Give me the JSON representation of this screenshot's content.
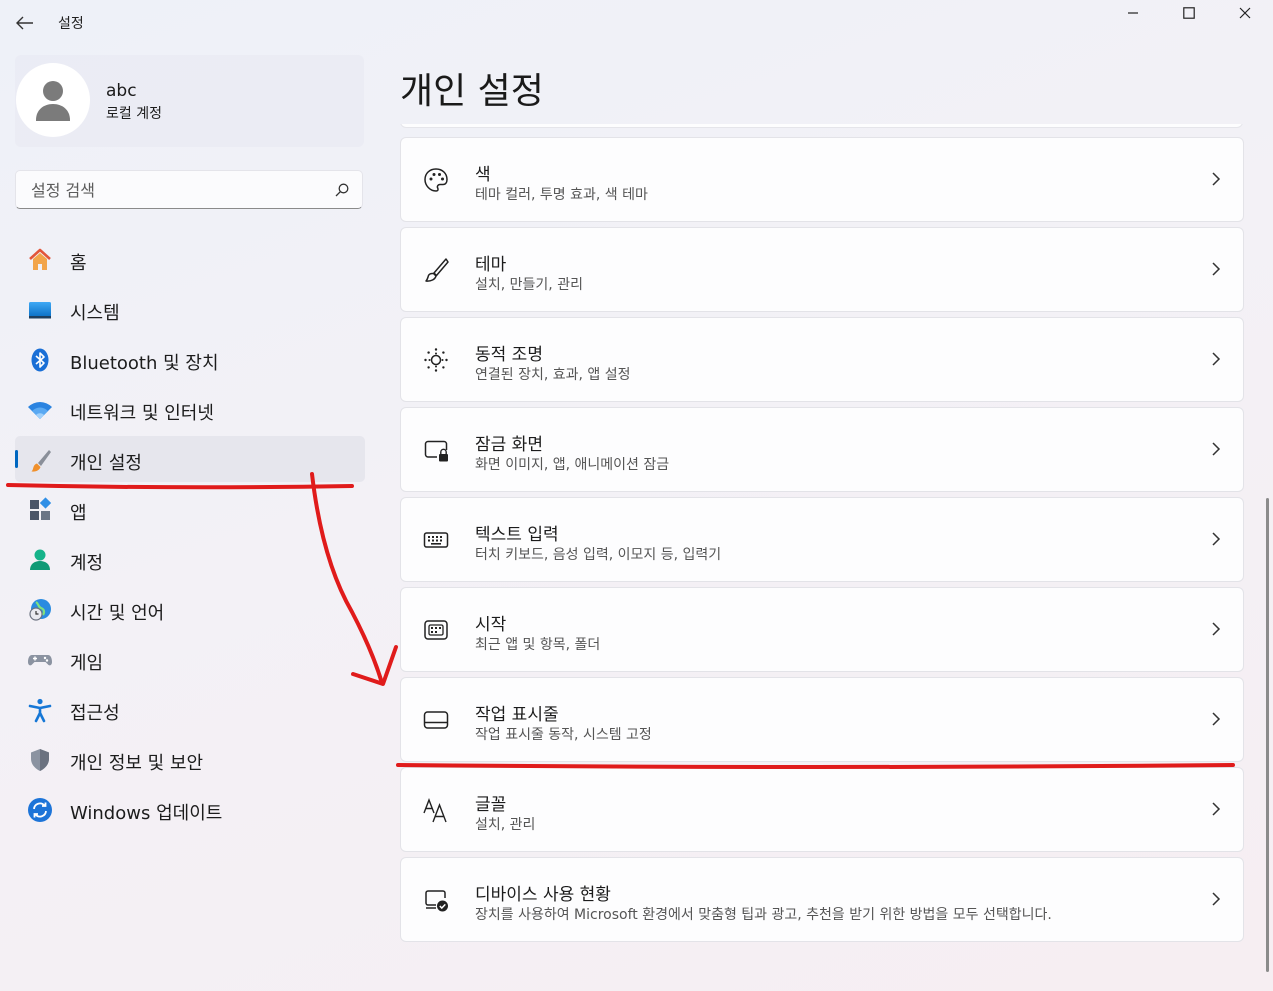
{
  "window": {
    "title": "설정"
  },
  "profile": {
    "name": "abc",
    "account_type": "로컬 계정"
  },
  "search": {
    "placeholder": "설정 검색"
  },
  "nav": {
    "items": [
      {
        "label": "홈",
        "icon": "home-icon"
      },
      {
        "label": "시스템",
        "icon": "system-icon"
      },
      {
        "label": "Bluetooth 및 장치",
        "icon": "bluetooth-icon"
      },
      {
        "label": "네트워크 및 인터넷",
        "icon": "wifi-icon"
      },
      {
        "label": "개인 설정",
        "icon": "paintbrush-icon",
        "active": true
      },
      {
        "label": "앱",
        "icon": "apps-icon"
      },
      {
        "label": "계정",
        "icon": "account-icon"
      },
      {
        "label": "시간 및 언어",
        "icon": "globe-clock-icon"
      },
      {
        "label": "게임",
        "icon": "gamepad-icon"
      },
      {
        "label": "접근성",
        "icon": "accessibility-icon"
      },
      {
        "label": "개인 정보 및 보안",
        "icon": "shield-icon"
      },
      {
        "label": "Windows 업데이트",
        "icon": "update-icon"
      }
    ]
  },
  "page": {
    "title": "개인 설정"
  },
  "cards": [
    {
      "title": "색",
      "subtitle": "테마 컬러, 투명 효과, 색 테마",
      "icon": "palette-icon"
    },
    {
      "title": "테마",
      "subtitle": "설치, 만들기, 관리",
      "icon": "brush-icon"
    },
    {
      "title": "동적 조명",
      "subtitle": "연결된 장치, 효과, 앱 설정",
      "icon": "dynamic-lighting-icon"
    },
    {
      "title": "잠금 화면",
      "subtitle": "화면 이미지, 앱, 애니메이션 잠금",
      "icon": "lock-screen-icon"
    },
    {
      "title": "텍스트 입력",
      "subtitle": "터치 키보드, 음성 입력, 이모지 등, 입력기",
      "icon": "keyboard-icon"
    },
    {
      "title": "시작",
      "subtitle": "최근 앱 및 항목, 폴더",
      "icon": "start-icon"
    },
    {
      "title": "작업 표시줄",
      "subtitle": "작업 표시줄 동작, 시스템 고정",
      "icon": "taskbar-icon"
    },
    {
      "title": "글꼴",
      "subtitle": "설치, 관리",
      "icon": "fonts-icon"
    },
    {
      "title": "디바이스 사용 현황",
      "subtitle": "장치를 사용하여 Microsoft 환경에서 맞춤형 팁과 광고, 추천을 받기 위한 방법을 모두 선택합니다.",
      "icon": "device-usage-icon"
    }
  ],
  "colors": {
    "accent": "#0067c0",
    "annotation": "#e01b1b"
  }
}
